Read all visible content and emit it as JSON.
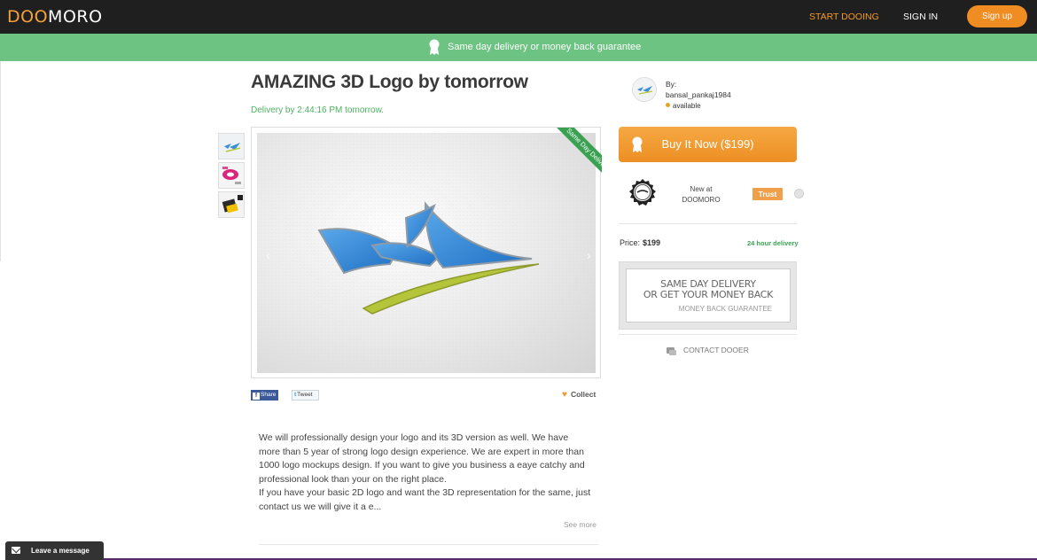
{
  "header": {
    "logo_part1": "DOO",
    "logo_part2": "MORO",
    "nav_start": "START DOOING",
    "nav_signin": "SIGN IN",
    "nav_signup": "Sign up",
    "colors": {
      "bar": "#1f1f1f",
      "accent": "#f39a2a"
    }
  },
  "banner": {
    "text": "Same day delivery or money back guarantee",
    "icon": "award-ribbon-icon",
    "color": "#6dc382"
  },
  "product": {
    "title": "AMAZING 3D Logo by tomorrow",
    "delivery": "Delivery by 2:44:16 PM tomorrow.",
    "ribbon": "Same Day Delivery",
    "thumbnails": [
      "logo-thumbnail-1",
      "logo-thumbnail-2",
      "logo-thumbnail-3"
    ],
    "share_label": "Share",
    "tweet_label": "Tweet",
    "collect_label": "Collect",
    "description": [
      "We will professionally design your logo and its 3D version as well. We have more than 5 year of strong logo design experience. We are expert in more than 1000 logo mockups design. If you want to give you business a eaye catchy and professional look than your on the right place.",
      "If you have your basic 2D logo and want the 3D representation for the same, just contact us we will give it a e..."
    ],
    "see_more": "See more"
  },
  "seller": {
    "by_label": "By:",
    "name": "bansal_pankaj1984",
    "status": "available",
    "status_color": "#e5a522"
  },
  "purchase": {
    "buy_label": "Buy It Now ($199)",
    "new_at_line1": "New at",
    "new_at_line2": "DOOMORO",
    "trust_label": "Trust",
    "price_label": "Price:",
    "price_value": "$199",
    "delivery_badge": "24 hour delivery",
    "guarantee_line1": "SAME DAY DELIVERY",
    "guarantee_line2": "OR GET YOUR MONEY BACK",
    "guarantee_line3": "MONEY BACK GUARANTEE",
    "contact_label": "CONTACT DOOER"
  },
  "chat": {
    "label": "Leave a message"
  }
}
